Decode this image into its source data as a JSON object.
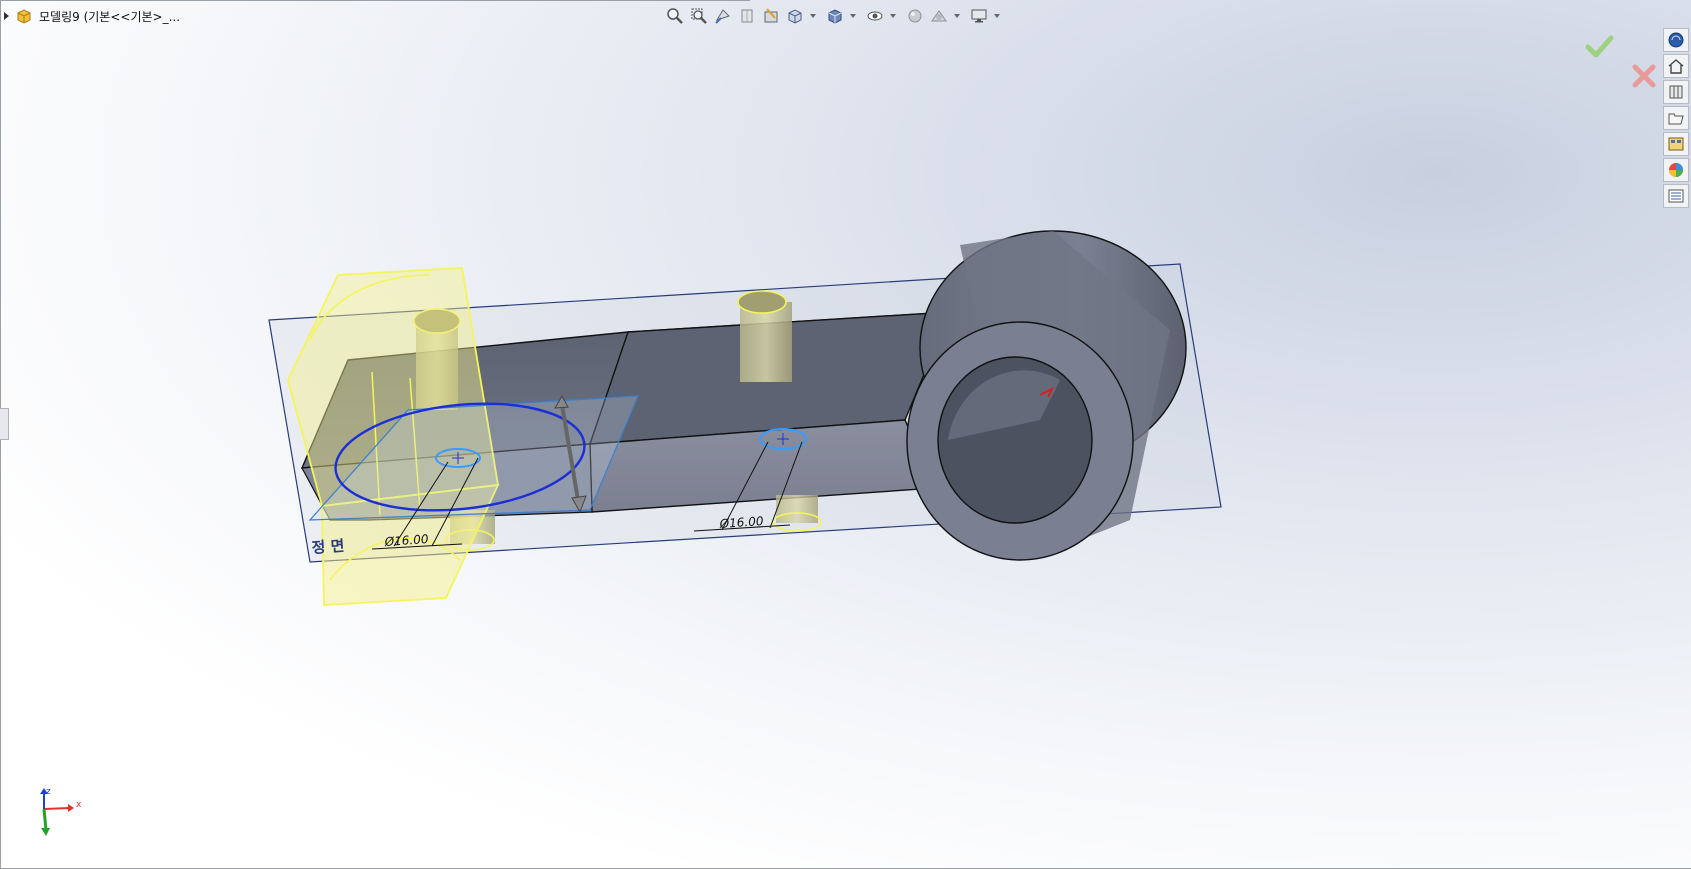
{
  "tree": {
    "title": "모델링9  (기본<<기본>_..."
  },
  "toolbar": {
    "icons": [
      "zoom-to-fit-icon",
      "zoom-to-area-icon",
      "previous-view-icon",
      "section-view-icon",
      "dynamic-annotation-icon",
      "view-orientation-icon",
      "display-style-icon",
      "hide-show-items-icon",
      "edit-appearance-icon",
      "apply-scene-icon",
      "view-settings-icon"
    ]
  },
  "viewport": {
    "plane_label": "정 면",
    "dimension_1": "Ø16.00",
    "dimension_2": "Ø16.00"
  },
  "triad": {
    "x": "x",
    "z": "z"
  },
  "colors": {
    "accent_green": "#6cc24a",
    "accent_red": "#e04040",
    "part_gray": "#747a8a",
    "selection_yellow": "#f5f55a",
    "sketch_blue": "#1b2fd6"
  }
}
